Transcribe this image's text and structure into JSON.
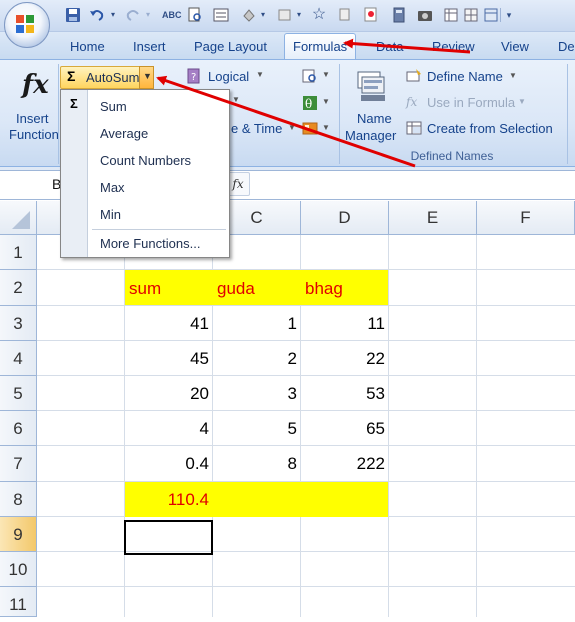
{
  "ribbon": {
    "tabs": [
      "Home",
      "Insert",
      "Page Layout",
      "Formulas",
      "Data",
      "Review",
      "View",
      "De"
    ],
    "active_tab": "Formulas",
    "insert_function": {
      "line1": "Insert",
      "line2": "Function"
    },
    "autosum_label": "AutoSum",
    "logical_label": "Logical",
    "date_time_fragment": "e & Time",
    "name_manager": {
      "line1": "Name",
      "line2": "Manager"
    },
    "define_name_label": "Define Name",
    "use_in_formula_label": "Use in Formula",
    "create_from_selection_label": "Create from Selection",
    "defined_names_group": "Defined Names"
  },
  "autosum_menu": {
    "items": [
      "Sum",
      "Average",
      "Count Numbers",
      "Max",
      "Min",
      "More Functions..."
    ]
  },
  "formula_bar": {
    "name_box": "B",
    "fx_label": "fx"
  },
  "sheet": {
    "columns": [
      "C",
      "D",
      "E",
      "F"
    ],
    "rows": [
      "1",
      "2",
      "3",
      "4",
      "5",
      "6",
      "7",
      "8",
      "9",
      "10",
      "11"
    ],
    "headers": {
      "b": "sum",
      "c": "guda",
      "d": "bhag"
    },
    "data": [
      {
        "b": "41",
        "c": "1",
        "d": "11"
      },
      {
        "b": "45",
        "c": "2",
        "d": "22"
      },
      {
        "b": "20",
        "c": "3",
        "d": "53"
      },
      {
        "b": "4",
        "c": "5",
        "d": "65"
      },
      {
        "b": "0.4",
        "c": "8",
        "d": "222"
      }
    ],
    "total": "110.4"
  },
  "colors": {
    "highlight": "#ffff00",
    "text_red": "#e00000",
    "ribbon_text": "#15428b",
    "annotation_arrow": "#e00000"
  }
}
